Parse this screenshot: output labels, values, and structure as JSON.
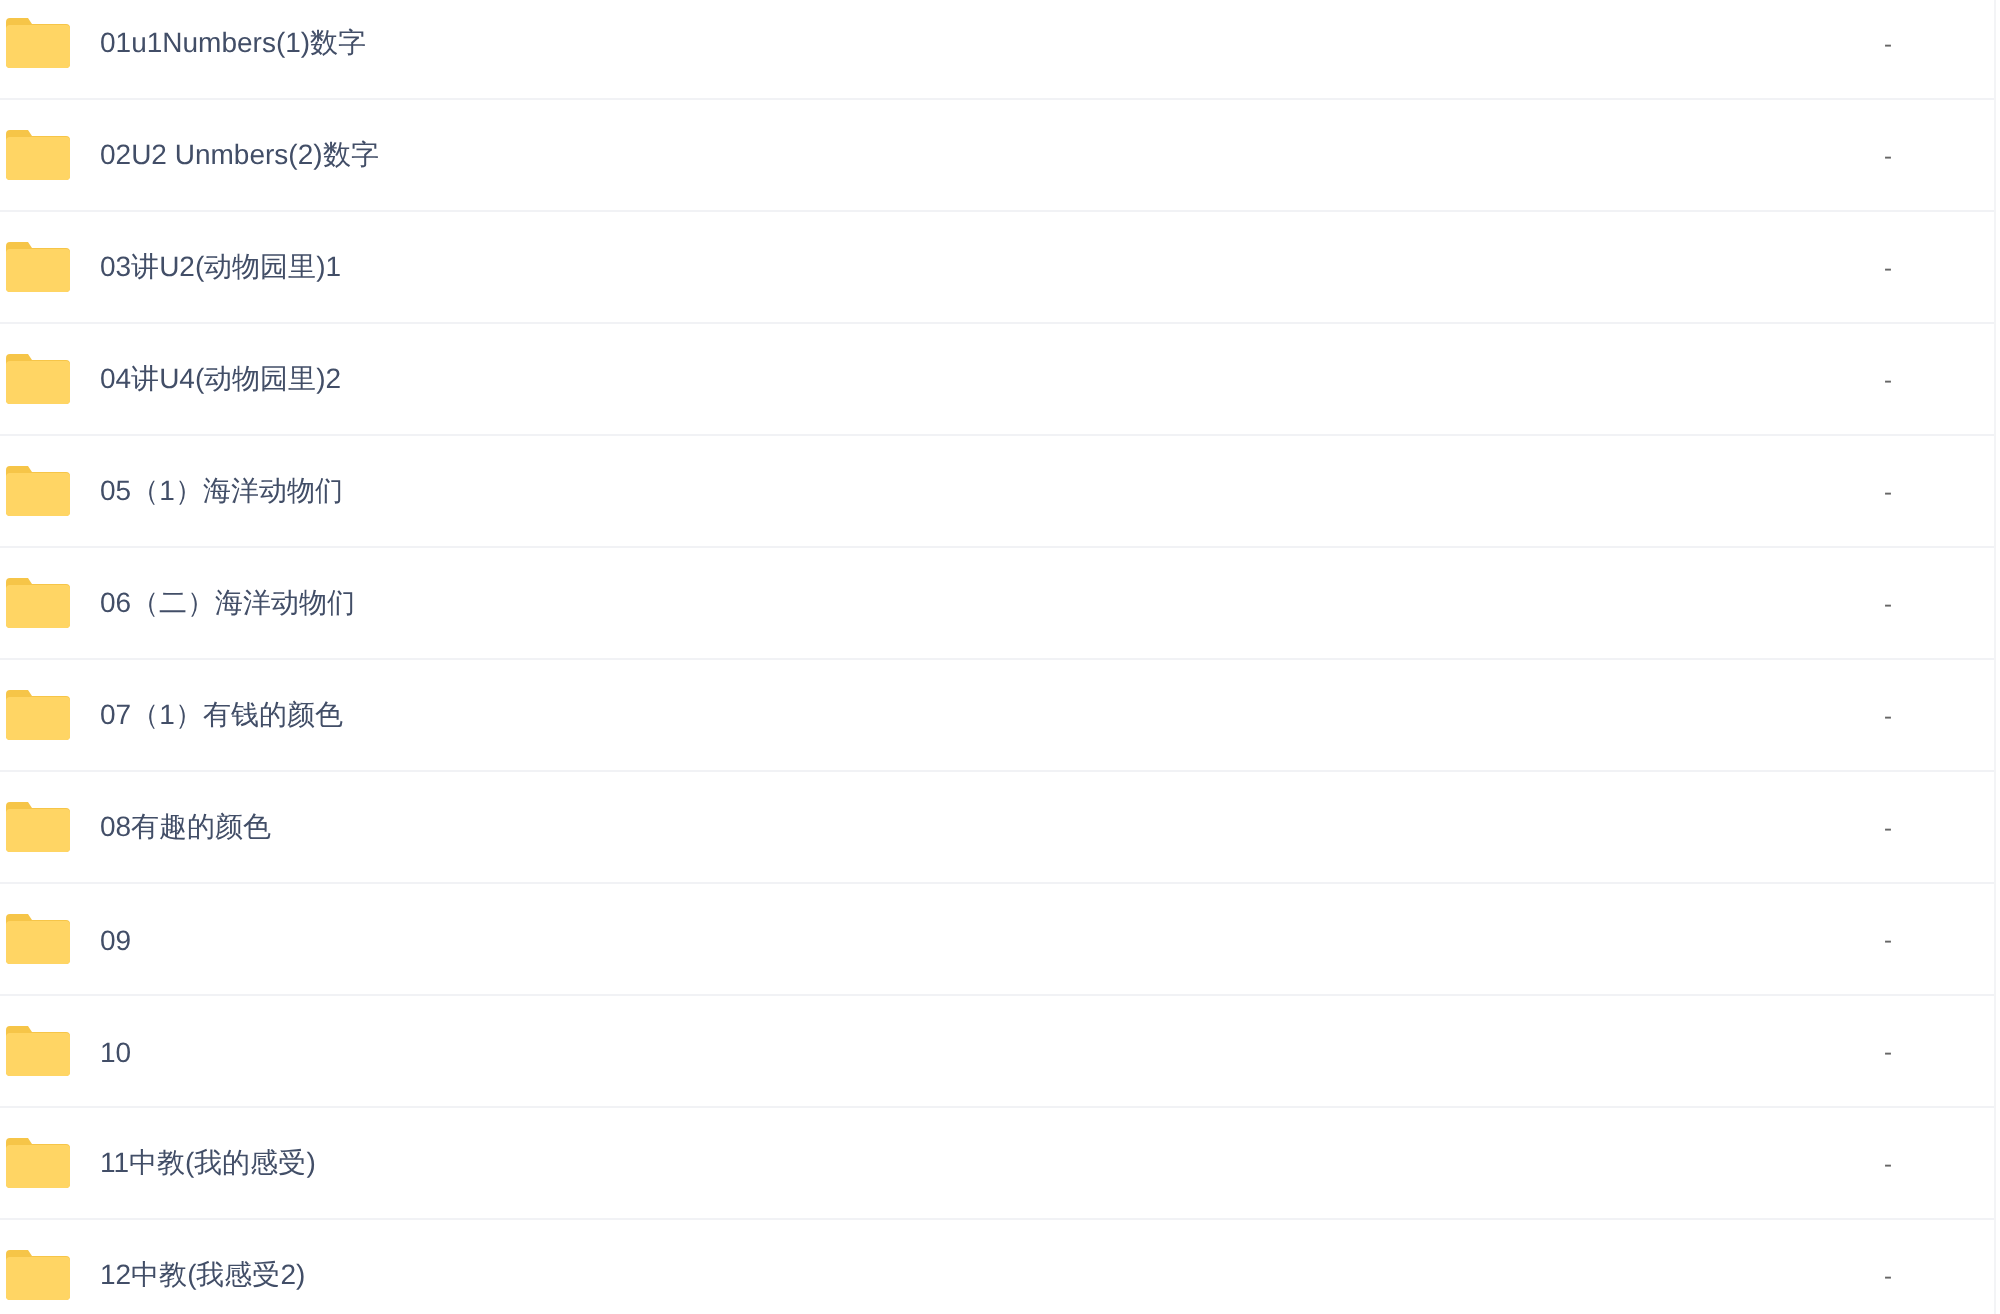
{
  "files": [
    {
      "name": "01u1Numbers(1)数字",
      "column_2": "-"
    },
    {
      "name": "02U2 Unmbers(2)数字",
      "column_2": "-"
    },
    {
      "name": "03讲U2(动物园里)1",
      "column_2": "-"
    },
    {
      "name": "04讲U4(动物园里)2",
      "column_2": "-"
    },
    {
      "name": "05（1）海洋动物们",
      "column_2": "-"
    },
    {
      "name": "06（二）海洋动物们",
      "column_2": "-"
    },
    {
      "name": "07（1）有钱的颜色",
      "column_2": "-"
    },
    {
      "name": "08有趣的颜色",
      "column_2": "-"
    },
    {
      "name": "09",
      "column_2": "-"
    },
    {
      "name": "10",
      "column_2": "-"
    },
    {
      "name": "11中教(我的感受)",
      "column_2": "-"
    },
    {
      "name": "12中教(我感受2)",
      "column_2": "-"
    }
  ]
}
